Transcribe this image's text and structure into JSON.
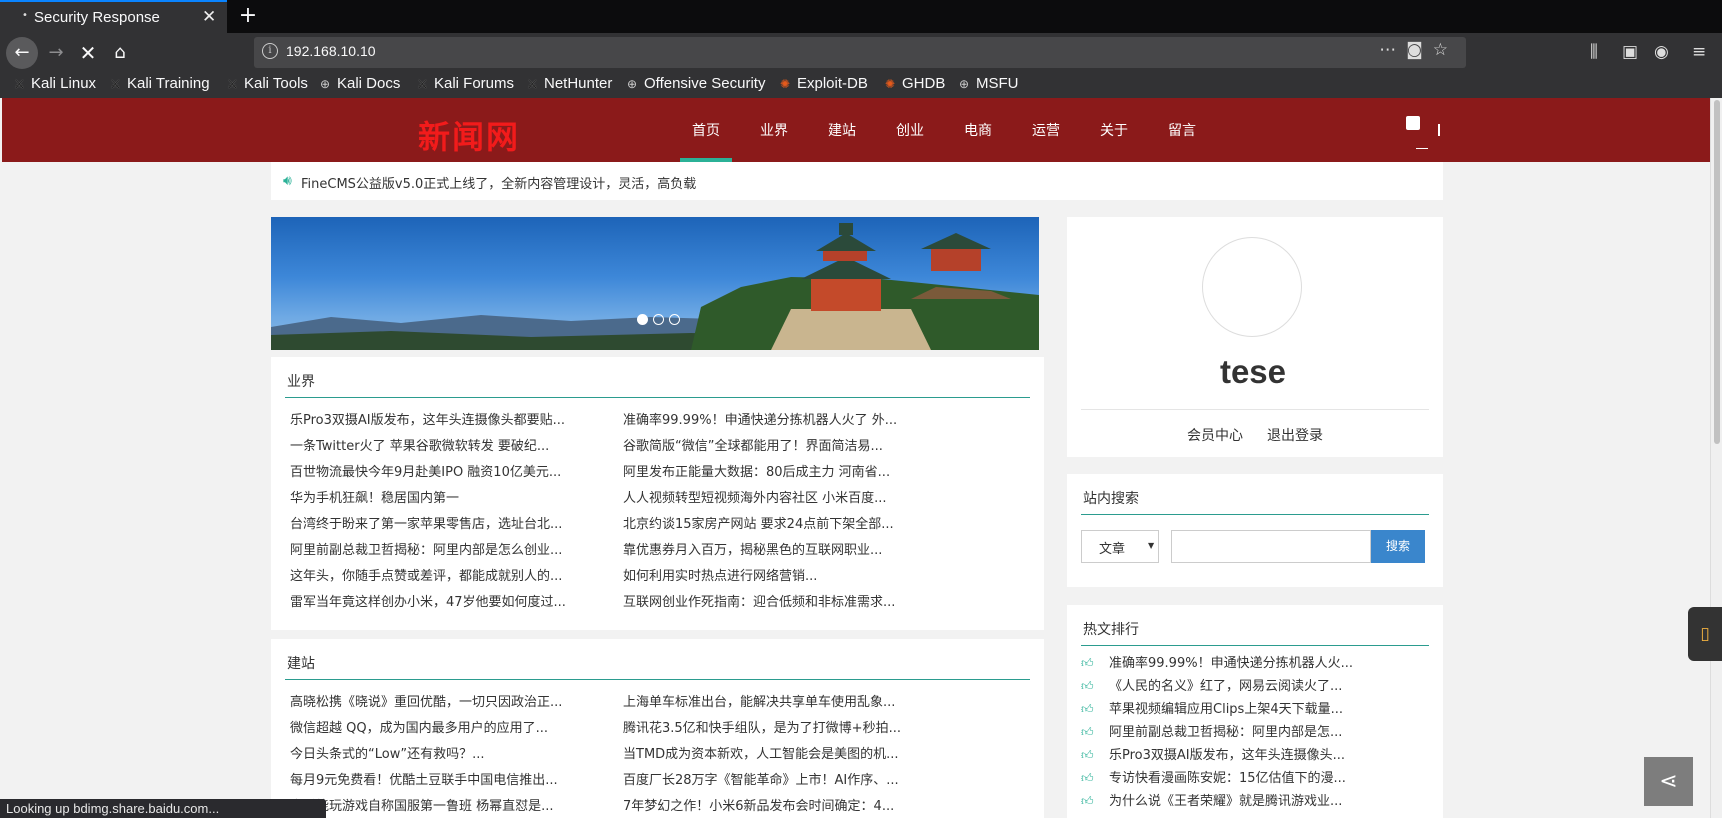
{
  "browser": {
    "tab_title": "Security Response",
    "url": "192.168.10.10",
    "status_text": "Looking up bdimg.share.baidu.com..."
  },
  "bookmarks": [
    {
      "label": "Kali Linux",
      "icon": "kali-dragon-icon"
    },
    {
      "label": "Kali Training",
      "icon": "kali-dragon-icon"
    },
    {
      "label": "Kali Tools",
      "icon": "kali-dragon-icon"
    },
    {
      "label": "Kali Docs",
      "icon": "globe-icon"
    },
    {
      "label": "Kali Forums",
      "icon": "kali-dragon-icon"
    },
    {
      "label": "NetHunter",
      "icon": "kali-dragon-icon"
    },
    {
      "label": "Offensive Security",
      "icon": "globe-icon"
    },
    {
      "label": "Exploit-DB",
      "icon": "exploit-db-icon"
    },
    {
      "label": "GHDB",
      "icon": "exploit-db-icon"
    },
    {
      "label": "MSFU",
      "icon": "globe-icon"
    }
  ],
  "site": {
    "logo": "新闻网",
    "menu": [
      "首页",
      "业界",
      "建站",
      "创业",
      "电商",
      "运营",
      "关于",
      "留言"
    ],
    "active_menu": "首页",
    "notice": "FineCMS公益版v5.0正式上线了，全新内容管理设计，灵活，高负载"
  },
  "sections": [
    {
      "title": "业界",
      "left": [
        "乐Pro3双摄AI版发布，这年头连摄像头都要贴...",
        "一条Twitter火了 苹果谷歌微软转发 要破纪...",
        "百世物流最快今年9月赴美IPO 融资10亿美元...",
        "华为手机狂飙！稳居国内第一",
        "台湾终于盼来了第一家苹果零售店，选址台北...",
        "阿里前副总裁卫哲揭秘：阿里内部是怎么创业...",
        "这年头，你随手点赞或差评，都能成就别人的...",
        "雷军当年竟这样创办小米，47岁他要如何度过..."
      ],
      "right": [
        "准确率99.99%！申通快递分拣机器人火了 外...",
        "谷歌简版“微信”全球都能用了！界面简洁易...",
        "阿里发布正能量大数据：80后成主力 河南省...",
        "人人视频转型短视频海外内容社区 小米百度...",
        "北京约谈15家房产网站 要求24点前下架全部...",
        "靠优惠券月入百万，揭秘黑色的互联网职业...",
        "如何利用实时热点进行网络营销...",
        "互联网创业作死指南：迎合低频和非标准需求..."
      ]
    },
    {
      "title": "建站",
      "left": [
        "高晓松携《晓说》重回优酷，一切只因政治正...",
        "微信超越 QQ，成为国内最多用户的应用了...",
        "今日头条式的“Low”还有救吗？...",
        "每月9元免费看！优酷土豆联手中国电信推出...",
        "高手能玩游戏自称国服第一鲁班 杨幂直怼是..."
      ],
      "right": [
        "上海单车标准出台，能解决共享单车使用乱象...",
        "腾讯花3.5亿和快手组队，是为了打微博+秒拍...",
        "当TMD成为资本新欢，人工智能会是美图的机...",
        "百度厂长28万字《智能革命》上市！AI作序、...",
        "7年梦幻之作！小米6新品发布会时间确定：4..."
      ]
    }
  ],
  "user": {
    "name": "tese",
    "member_center": "会员中心",
    "logout": "退出登录"
  },
  "search": {
    "title": "站内搜索",
    "select_value": "文章",
    "input_value": "",
    "button": "搜索"
  },
  "hot": {
    "title": "热文排行",
    "items": [
      "准确率99.99%！申通快递分拣机器人火...",
      "《人民的名义》红了，网易云阅读火了...",
      "苹果视频编辑应用Clips上架4天下载量...",
      "阿里前副总裁卫哲揭秘：阿里内部是怎...",
      "乐Pro3双摄AI版发布，这年头连摄像头...",
      "专访快看漫画陈安妮：15亿估值下的漫...",
      "为什么说《王者荣耀》就是腾讯游戏业..."
    ]
  },
  "colors": {
    "header_bg": "#8b1a1a",
    "logo": "#f21b1b",
    "accent": "#2bb197",
    "search_button": "#3a86cc"
  }
}
